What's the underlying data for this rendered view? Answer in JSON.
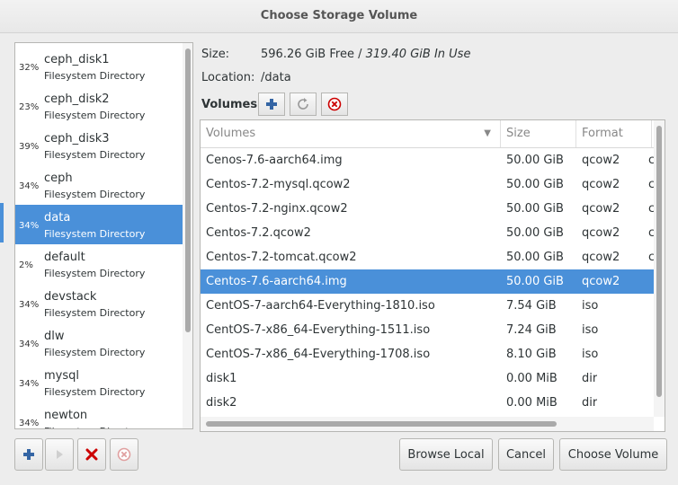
{
  "window": {
    "title": "Choose Storage Volume"
  },
  "pools": [
    {
      "percent": "32%",
      "name": "ceph_disk1",
      "type": "Filesystem Directory"
    },
    {
      "percent": "23%",
      "name": "ceph_disk2",
      "type": "Filesystem Directory"
    },
    {
      "percent": "39%",
      "name": "ceph_disk3",
      "type": "Filesystem Directory"
    },
    {
      "percent": "34%",
      "name": "ceph",
      "type": "Filesystem Directory"
    },
    {
      "percent": "34%",
      "name": "data",
      "type": "Filesystem Directory"
    },
    {
      "percent": "2%",
      "name": "default",
      "type": "Filesystem Directory"
    },
    {
      "percent": "34%",
      "name": "devstack",
      "type": "Filesystem Directory"
    },
    {
      "percent": "34%",
      "name": "dlw",
      "type": "Filesystem Directory"
    },
    {
      "percent": "34%",
      "name": "mysql",
      "type": "Filesystem Directory"
    },
    {
      "percent": "34%",
      "name": "newton",
      "type": "Filesystem Directory"
    }
  ],
  "info": {
    "size_label": "Size:",
    "size_free": "596.26 GiB Free / ",
    "size_inuse": "319.40 GiB In Use",
    "location_label": "Location:",
    "location_value": "/data"
  },
  "volumes_section": {
    "title": "Volumes"
  },
  "table": {
    "headers": {
      "name": "Volumes",
      "size": "Size",
      "format": "Format"
    },
    "rows": [
      {
        "name": "Cenos-7.6-aarch64.img",
        "size": "50.00 GiB",
        "format": "qcow2",
        "extra": "c"
      },
      {
        "name": "Centos-7.2-mysql.qcow2",
        "size": "50.00 GiB",
        "format": "qcow2",
        "extra": "c"
      },
      {
        "name": "Centos-7.2-nginx.qcow2",
        "size": "50.00 GiB",
        "format": "qcow2",
        "extra": "c"
      },
      {
        "name": "Centos-7.2.qcow2",
        "size": "50.00 GiB",
        "format": "qcow2",
        "extra": "c"
      },
      {
        "name": "Centos-7.2-tomcat.qcow2",
        "size": "50.00 GiB",
        "format": "qcow2",
        "extra": "c"
      },
      {
        "name": "Centos-7.6-aarch64.img",
        "size": "50.00 GiB",
        "format": "qcow2",
        "extra": ""
      },
      {
        "name": "CentOS-7-aarch64-Everything-1810.iso",
        "size": "7.54 GiB",
        "format": "iso",
        "extra": ""
      },
      {
        "name": "CentOS-7-x86_64-Everything-1511.iso",
        "size": "7.24 GiB",
        "format": "iso",
        "extra": ""
      },
      {
        "name": "CentOS-7-x86_64-Everything-1708.iso",
        "size": "8.10 GiB",
        "format": "iso",
        "extra": ""
      },
      {
        "name": "disk1",
        "size": "0.00 MiB",
        "format": "dir",
        "extra": ""
      },
      {
        "name": "disk2",
        "size": "0.00 MiB",
        "format": "dir",
        "extra": ""
      }
    ]
  },
  "buttons": {
    "browse_local": "Browse Local",
    "cancel": "Cancel",
    "choose_volume": "Choose Volume"
  },
  "colors": {
    "selection": "#4a90d9",
    "add": "#3465a4",
    "delete": "#cc0000"
  }
}
